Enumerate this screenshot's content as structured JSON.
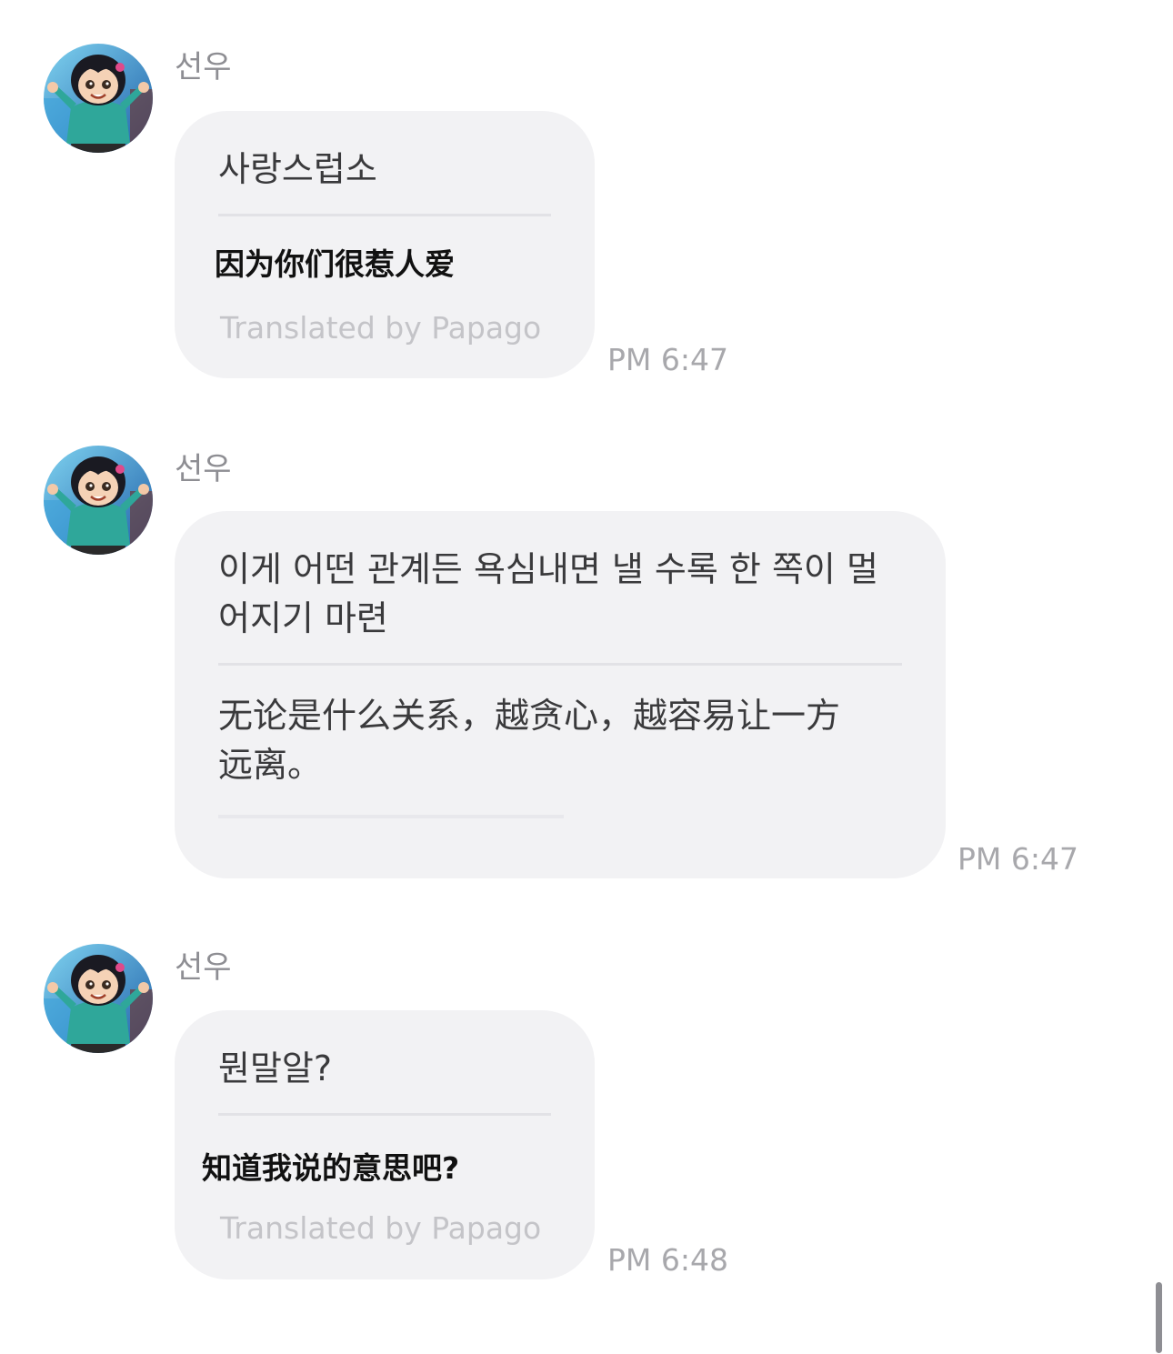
{
  "messages": [
    {
      "sender": "선우",
      "avatar_icon": "cartoon-girl-avatar-icon",
      "original": "사랑스럽소",
      "translation": "因为你们很惹人爱",
      "credit": "Translated by Papago",
      "time": "PM 6:47"
    },
    {
      "sender": "선우",
      "avatar_icon": "cartoon-girl-avatar-icon",
      "original_line1": "이게 어떤 관계든 욕심내면 낼 수록 한 쪽이 멀",
      "original_line2": "어지기 마련",
      "translation_line1": "无论是什么关系，越贪心，越容易让一方",
      "translation_line2": "远离。",
      "time": "PM 6:47"
    },
    {
      "sender": "선우",
      "avatar_icon": "cartoon-girl-avatar-icon",
      "original": "뭔말알?",
      "translation": "知道我说的意思吧?",
      "credit": "Translated by Papago",
      "time": "PM 6:48"
    }
  ],
  "colors": {
    "bubble_bg": "#f2f2f4",
    "sender_text": "#8e8e93",
    "timestamp_text": "#a8a8ac",
    "credit_text": "#c4c4c8"
  }
}
